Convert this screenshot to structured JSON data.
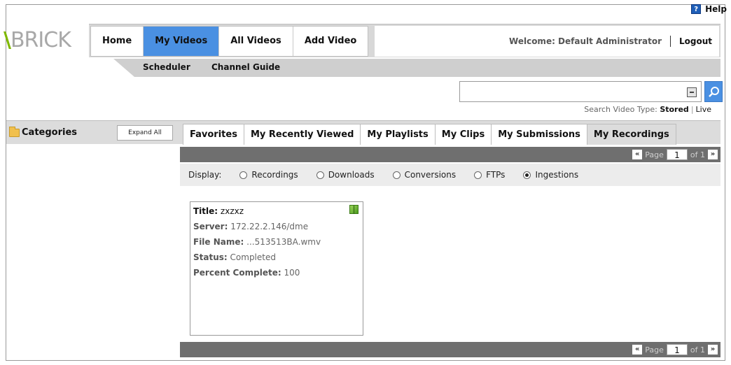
{
  "help": {
    "icon_text": "?",
    "label": "Help"
  },
  "logo": {
    "v": "\\",
    "text": "BRICK"
  },
  "nav": {
    "tabs": [
      {
        "label": "Home",
        "active": false
      },
      {
        "label": "My Videos",
        "active": true
      },
      {
        "label": "All Videos",
        "active": false
      },
      {
        "label": "Add Video",
        "active": false
      }
    ],
    "welcome": "Welcome: Default Administrator",
    "logout": "Logout"
  },
  "subnav": {
    "items": [
      "Scheduler",
      "Channel Guide"
    ]
  },
  "search": {
    "value": "",
    "placeholder": "",
    "type_label": "Search Video Type:",
    "stored": "Stored",
    "pipe": "|",
    "live": "Live"
  },
  "categories": {
    "title": "Categories",
    "expand_label": "Expand All"
  },
  "tabs": [
    "Favorites",
    "My Recently Viewed",
    "My Playlists",
    "My Clips",
    "My Submissions",
    "My Recordings"
  ],
  "active_tab": "My Recordings",
  "pager": {
    "prev": "«",
    "page_label": "Page",
    "page": "1",
    "of": "of 1",
    "next": "»"
  },
  "display": {
    "label": "Display:",
    "options": [
      {
        "label": "Recordings",
        "checked": false
      },
      {
        "label": "Downloads",
        "checked": false
      },
      {
        "label": "Conversions",
        "checked": false
      },
      {
        "label": "FTPs",
        "checked": false
      },
      {
        "label": "Ingestions",
        "checked": true
      }
    ]
  },
  "card": {
    "title_label": "Title:",
    "title": "zxzxz",
    "server_label": "Server:",
    "server": "172.22.2.146/dme",
    "file_label": "File Name:",
    "file": "...513513BA.wmv",
    "status_label": "Status:",
    "status": "Completed",
    "percent_label": "Percent Complete:",
    "percent": "100"
  }
}
